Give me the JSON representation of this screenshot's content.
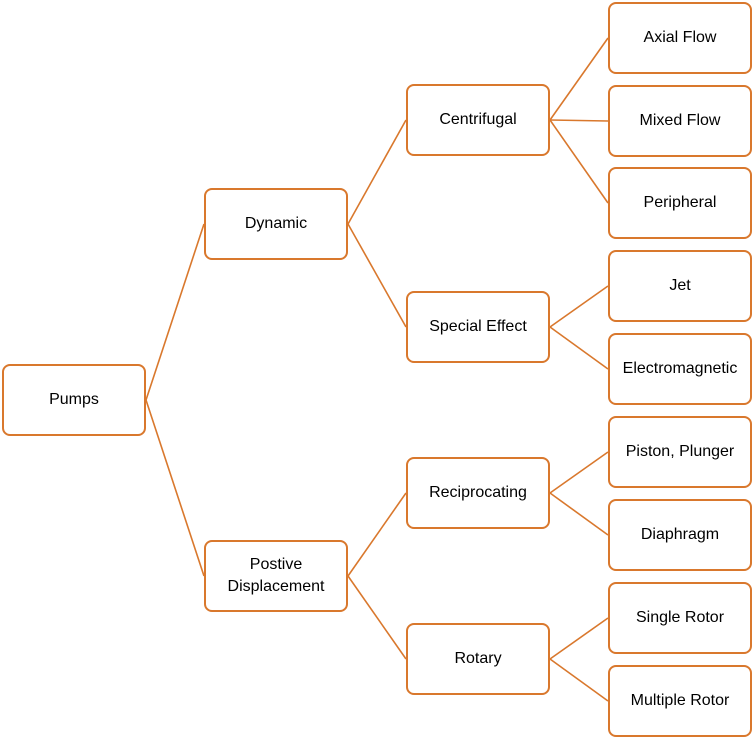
{
  "diagram": {
    "type": "tree",
    "accent_color": "#D9782D",
    "root": {
      "id": "pumps",
      "label": "Pumps"
    },
    "nodes": [
      {
        "id": "pumps",
        "label": "Pumps",
        "parent": null
      },
      {
        "id": "dynamic",
        "label": "Dynamic",
        "parent": "pumps"
      },
      {
        "id": "positive",
        "label": "Postive\nDisplacement",
        "parent": "pumps"
      },
      {
        "id": "centrifugal",
        "label": "Centrifugal",
        "parent": "dynamic"
      },
      {
        "id": "special",
        "label": "Special Effect",
        "parent": "dynamic"
      },
      {
        "id": "reciprocating",
        "label": "Reciprocating",
        "parent": "positive"
      },
      {
        "id": "rotary",
        "label": "Rotary",
        "parent": "positive"
      },
      {
        "id": "axial",
        "label": "Axial Flow",
        "parent": "centrifugal"
      },
      {
        "id": "mixed",
        "label": "Mixed Flow",
        "parent": "centrifugal"
      },
      {
        "id": "peripheral",
        "label": "Peripheral",
        "parent": "centrifugal"
      },
      {
        "id": "jet",
        "label": "Jet",
        "parent": "special"
      },
      {
        "id": "electromagnetic",
        "label": "Electromagnetic",
        "parent": "special"
      },
      {
        "id": "piston",
        "label": "Piston, Plunger",
        "parent": "reciprocating"
      },
      {
        "id": "diaphragm",
        "label": "Diaphragm",
        "parent": "reciprocating"
      },
      {
        "id": "single",
        "label": "Single Rotor",
        "parent": "rotary"
      },
      {
        "id": "multiple",
        "label": "Multiple Rotor",
        "parent": "rotary"
      }
    ]
  }
}
